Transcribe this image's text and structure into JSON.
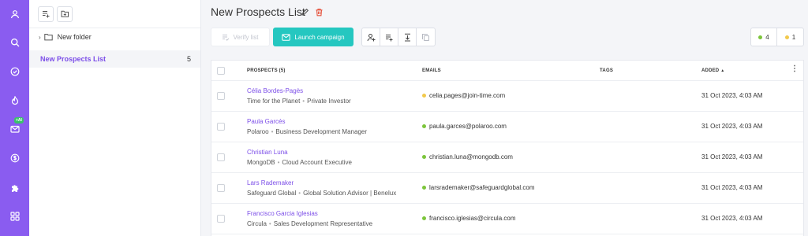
{
  "colors": {
    "accent": "#8a5cf0",
    "launch": "#25c7c0",
    "valid": "#7cc53b",
    "risky": "#f2c94c"
  },
  "rail": {
    "icons": [
      "user-icon",
      "search-icon",
      "check-circle-icon",
      "flame-icon",
      "mail-icon",
      "dollar-icon",
      "puzzle-icon",
      "grid-icon"
    ],
    "badge": "+AI"
  },
  "sidebar": {
    "folder": "New folder",
    "list": {
      "name": "New Prospects List",
      "count": "5"
    }
  },
  "header": {
    "title": "New Prospects List"
  },
  "toolbar": {
    "verify": "Verify list",
    "launch": "Launch campaign"
  },
  "counts": {
    "valid": "4",
    "risky": "1"
  },
  "table": {
    "columns": {
      "prospects": "PROSPECTS (5)",
      "emails": "EMAILS",
      "tags": "TAGS",
      "added": "ADDED"
    },
    "rows": [
      {
        "name": "Célia Bordes-Pagès",
        "company": "Time for the Planet",
        "title": "Private Investor",
        "email": "celia.pages@join-time.com",
        "status": "risky",
        "added": "31 Oct 2023, 4:03 AM"
      },
      {
        "name": "Paula Garcés",
        "company": "Polaroo",
        "title": "Business Development Manager",
        "email": "paula.garces@polaroo.com",
        "status": "valid",
        "added": "31 Oct 2023, 4:03 AM"
      },
      {
        "name": "Christian Luna",
        "company": "MongoDB",
        "title": "Cloud Account Executive",
        "email": "christian.luna@mongodb.com",
        "status": "valid",
        "added": "31 Oct 2023, 4:03 AM"
      },
      {
        "name": "Lars Rademaker",
        "company": "Safeguard Global",
        "title": "Global Solution Advisor | Benelux",
        "email": "larsrademaker@safeguardglobal.com",
        "status": "valid",
        "added": "31 Oct 2023, 4:03 AM"
      },
      {
        "name": "Francisco Garcia Iglesias",
        "company": "Circula",
        "title": "Sales Development Representative",
        "email": "francisco.iglesias@circula.com",
        "status": "valid",
        "added": "31 Oct 2023, 4:03 AM"
      }
    ]
  }
}
